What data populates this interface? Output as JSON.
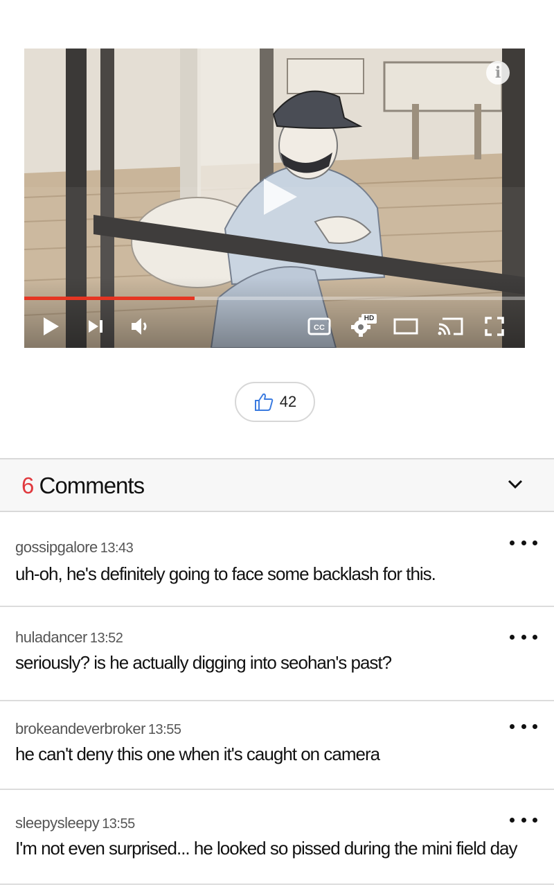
{
  "video": {
    "progress_fraction": 0.34,
    "accent_color": "#e53522",
    "controls": [
      "play-icon",
      "skip-next-icon",
      "volume-icon",
      "captions-icon",
      "settings-icon",
      "miniplayer-icon",
      "cast-icon",
      "fullscreen-icon"
    ],
    "captions_label": "CC",
    "hd_badge": "HD",
    "info_label": "i"
  },
  "like": {
    "count": "42",
    "icon": "thumbs-up-icon"
  },
  "comments": {
    "count": "6",
    "title": "Comments",
    "count_color": "#e0393e",
    "items": [
      {
        "user": "gossipgalore",
        "time": "13:43",
        "text": "uh-oh, he's definitely going to face some backlash for this."
      },
      {
        "user": "huladancer",
        "time": "13:52",
        "text": "seriously? is he actually digging into seohan's past?"
      },
      {
        "user": "brokeandeverbroker",
        "time": "13:55",
        "text": "he can't deny this one when it's caught on camera"
      },
      {
        "user": "sleepysleepy",
        "time": "13:55",
        "text": "I'm not even surprised... he looked so pissed during the mini field day"
      }
    ]
  }
}
